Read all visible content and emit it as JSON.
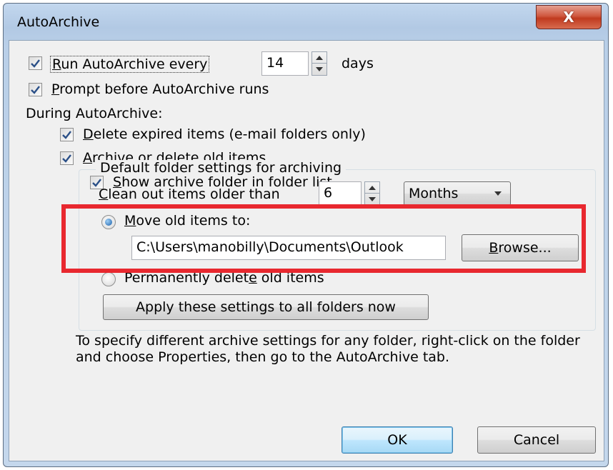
{
  "window": {
    "title": "AutoArchive",
    "close_glyph": "X"
  },
  "options": {
    "run_every": {
      "label_pre": "R",
      "label_post": "un AutoArchive every",
      "checked": true,
      "value": "14",
      "unit": "days"
    },
    "prompt": {
      "label_pre": "P",
      "label_post": "rompt before AutoArchive runs",
      "checked": true
    },
    "during_label": "During AutoArchive:",
    "delete_expired": {
      "label_pre": "D",
      "label_post": "elete expired items (e-mail folders only)",
      "checked": true
    },
    "archive_old": {
      "label_pre": "A",
      "label_post": "rchive or delete old items",
      "checked": true
    },
    "show_folder": {
      "label_pre": "S",
      "label_post": "how archive folder in folder list",
      "checked": true
    }
  },
  "default_settings": {
    "legend": "Default folder settings for archiving",
    "clean_out": {
      "label_pre": "C",
      "label_post": "lean out items older than",
      "value": "6",
      "unit_selected": "Months"
    },
    "move_to": {
      "label_pre": "M",
      "label_post": "ove old items to:",
      "selected": true,
      "path": "C:\\Users\\manobilly\\Documents\\Outlook"
    },
    "browse_label_pre": "B",
    "browse_label_post": "rowse...",
    "perm_delete": {
      "label_before": "Permanently delet",
      "label_underlined": "e",
      "label_after": " old items",
      "selected": false
    },
    "apply_label": "Apply these settings to all folders now"
  },
  "info_text": "To specify different archive settings for any folder, right-click on the folder and choose Properties, then go to the AutoArchive tab.",
  "buttons": {
    "ok": "OK",
    "cancel": "Cancel"
  },
  "colors": {
    "highlight": "#e8282f",
    "accent": "#1b5fa8"
  },
  "icons": {
    "check": "check-icon",
    "close": "close-icon"
  }
}
